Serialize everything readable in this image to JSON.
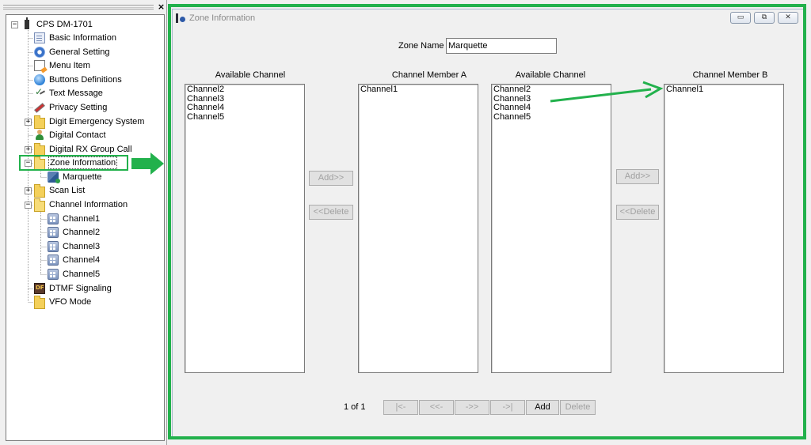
{
  "tree": {
    "close_glyph": "×",
    "root": {
      "label": "CPS DM-1701",
      "icon": "radio-icon",
      "expander": "−"
    },
    "items": [
      {
        "label": "Basic Information",
        "icon": "document-icon"
      },
      {
        "label": "General Setting",
        "icon": "gear-icon"
      },
      {
        "label": "Menu Item",
        "icon": "menu-icon"
      },
      {
        "label": "Buttons Definitions",
        "icon": "globe-icon"
      },
      {
        "label": "Text Message",
        "icon": "message-icon"
      },
      {
        "label": "Privacy Setting",
        "icon": "privacy-icon"
      },
      {
        "label": "Digit Emergency System",
        "icon": "folder-icon",
        "expander": "+"
      },
      {
        "label": "Digital Contact",
        "icon": "contact-icon"
      },
      {
        "label": "Digital RX Group Call",
        "icon": "folder-icon",
        "expander": "+"
      },
      {
        "label": "Zone Information",
        "icon": "folder-open-icon",
        "expander": "−",
        "selected": true
      },
      {
        "label": "Marquette",
        "icon": "zone-channel-icon",
        "child": true
      },
      {
        "label": "Scan List",
        "icon": "folder-icon",
        "expander": "+"
      },
      {
        "label": "Channel Information",
        "icon": "folder-open-icon",
        "expander": "−"
      },
      {
        "label": "Channel1",
        "icon": "channel-icon",
        "child": true
      },
      {
        "label": "Channel2",
        "icon": "channel-icon",
        "child": true
      },
      {
        "label": "Channel3",
        "icon": "channel-icon",
        "child": true
      },
      {
        "label": "Channel4",
        "icon": "channel-icon",
        "child": true
      },
      {
        "label": "Channel5",
        "icon": "channel-icon",
        "child": true
      },
      {
        "label": "DTMF Signaling",
        "icon": "dtmf-icon"
      },
      {
        "label": "VFO Mode",
        "icon": "folder-icon"
      }
    ]
  },
  "window": {
    "title": "Zone Information",
    "minimize": "▭",
    "restore": "⧉",
    "close": "✕"
  },
  "zone": {
    "name_label": "Zone Name",
    "name_value": "Marquette"
  },
  "lists": {
    "available_a": {
      "header": "Available Channel",
      "items": [
        "Channel2",
        "Channel3",
        "Channel4",
        "Channel5"
      ]
    },
    "member_a": {
      "header": "Channel Member A",
      "items": [
        "Channel1"
      ]
    },
    "available_b": {
      "header": "Available Channel",
      "items": [
        "Channel2",
        "Channel3",
        "Channel4",
        "Channel5"
      ]
    },
    "member_b": {
      "header": "Channel Member B",
      "items": [
        "Channel1"
      ]
    }
  },
  "buttons": {
    "add_a": "Add>>",
    "delete_a": "<<Delete",
    "add_b": "Add>>",
    "delete_b": "<<Delete"
  },
  "pager": {
    "status": "1 of 1",
    "first": "|<-",
    "prev": "<<-",
    "next": "->>",
    "last": "->|",
    "add": "Add",
    "delete": "Delete"
  },
  "annotation_color": "#22b14c"
}
